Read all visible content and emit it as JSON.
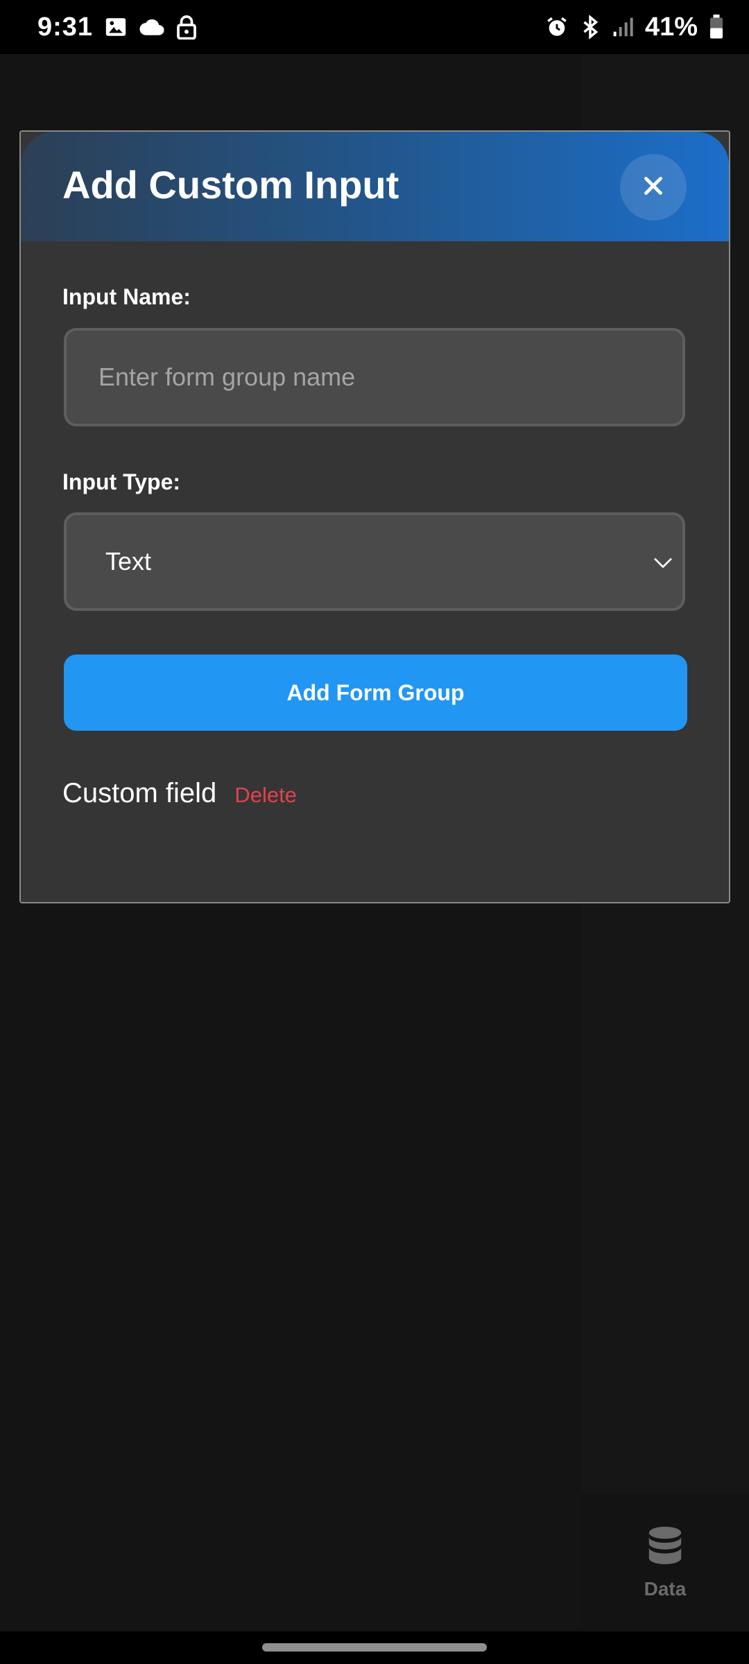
{
  "status_bar": {
    "time": "9:31",
    "battery_pct": "41%",
    "left_icons": [
      "image-icon",
      "cloud-icon",
      "lock-icon"
    ],
    "right_icons": [
      "alarm-icon",
      "bluetooth-icon",
      "signal-icon",
      "battery-icon"
    ]
  },
  "modal": {
    "title": "Add Custom Input",
    "close_icon": "close-icon",
    "name_label": "Input Name:",
    "name_placeholder": "Enter form group name",
    "name_value": "",
    "type_label": "Input Type:",
    "type_selected": "Text",
    "submit_label": "Add Form Group",
    "custom_fields": [
      {
        "name": "Custom field",
        "delete_label": "Delete"
      }
    ]
  },
  "bottom_nav": {
    "data_label": "Data",
    "data_icon": "database-icon"
  },
  "colors": {
    "accent": "#2196f3",
    "danger": "#e0434f",
    "modal_bg": "#353535",
    "header_gradient_start": "#2c3f55",
    "header_gradient_end": "#1c6ec9"
  }
}
